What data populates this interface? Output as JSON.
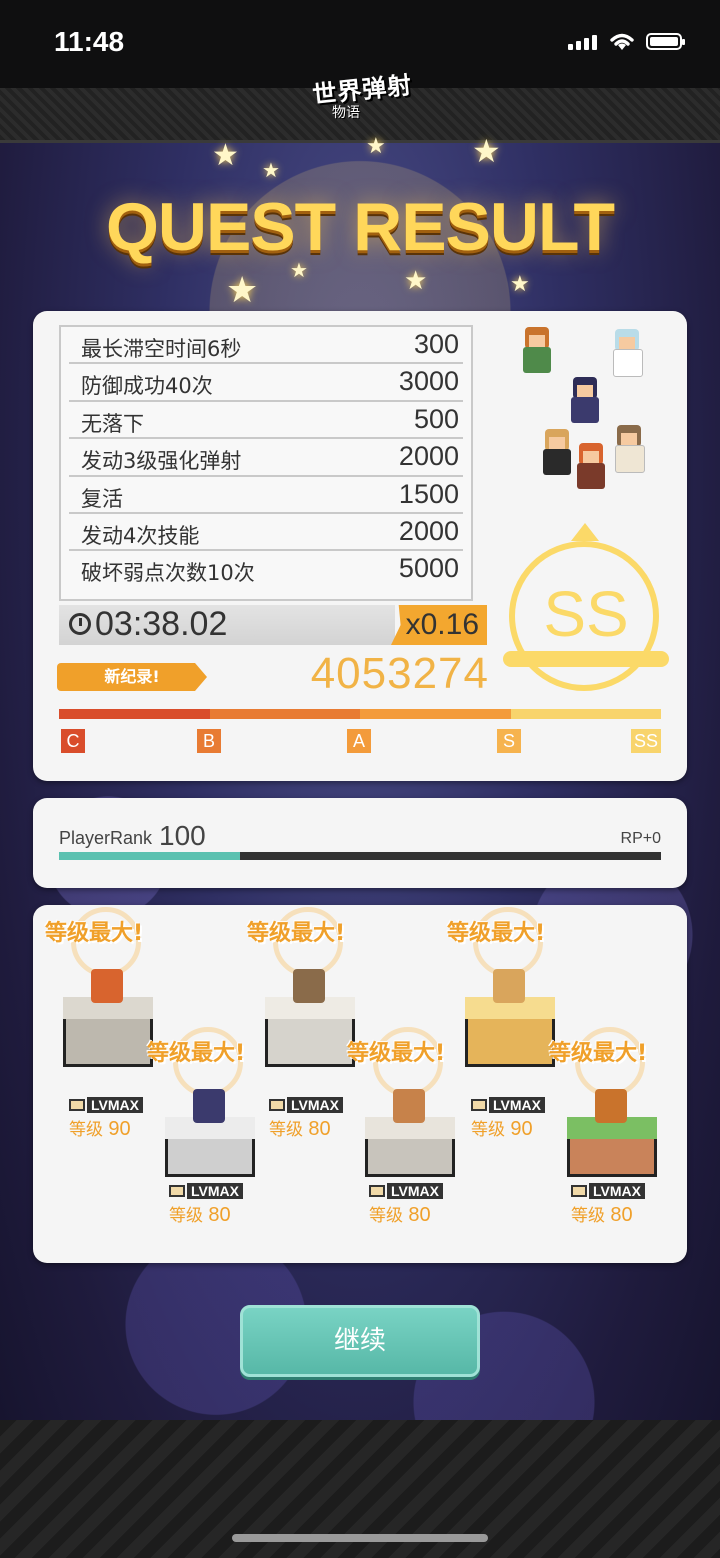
{
  "status_bar": {
    "time": "11:48"
  },
  "header": {
    "logo_text": "世界弹射",
    "logo_sub": "物语"
  },
  "title": "QUEST RESULT",
  "missions": [
    {
      "label": "最长滞空时间6秒",
      "value": "300"
    },
    {
      "label": "防御成功40次",
      "value": "3000"
    },
    {
      "label": "无落下",
      "value": "500"
    },
    {
      "label": "发动3级强化弹射",
      "value": "2000"
    },
    {
      "label": "复活",
      "value": "1500"
    },
    {
      "label": "发动4次技能",
      "value": "2000"
    },
    {
      "label": "破坏弱点次数10次",
      "value": "5000"
    }
  ],
  "timer": {
    "value": "03:38.02",
    "multiplier": "x0.16"
  },
  "new_record_label": "新纪录!",
  "score": "4053274",
  "rank_scale": [
    "C",
    "B",
    "A",
    "S",
    "SS"
  ],
  "rank_badge": "SS",
  "player_rank": {
    "label": "PlayerRank",
    "value": "100",
    "rp": "RP+0",
    "progress": 0.3
  },
  "units": [
    {
      "max_label": "等级最大!",
      "lv_badge": "LVMAX",
      "level_prefix": "等级",
      "level": "90"
    },
    {
      "max_label": "等级最大!",
      "lv_badge": "LVMAX",
      "level_prefix": "等级",
      "level": "80"
    },
    {
      "max_label": "等级最大!",
      "lv_badge": "LVMAX",
      "level_prefix": "等级",
      "level": "80"
    },
    {
      "max_label": "等级最大!",
      "lv_badge": "LVMAX",
      "level_prefix": "等级",
      "level": "80"
    },
    {
      "max_label": "等级最大!",
      "lv_badge": "LVMAX",
      "level_prefix": "等级",
      "level": "90"
    },
    {
      "max_label": "等级最大!",
      "lv_badge": "LVMAX",
      "level_prefix": "等级",
      "level": "80"
    }
  ],
  "continue_button": "继续",
  "colors": {
    "accent_orange": "#f0a02a",
    "gold": "#fbd968",
    "teal": "#5bc1b0"
  }
}
